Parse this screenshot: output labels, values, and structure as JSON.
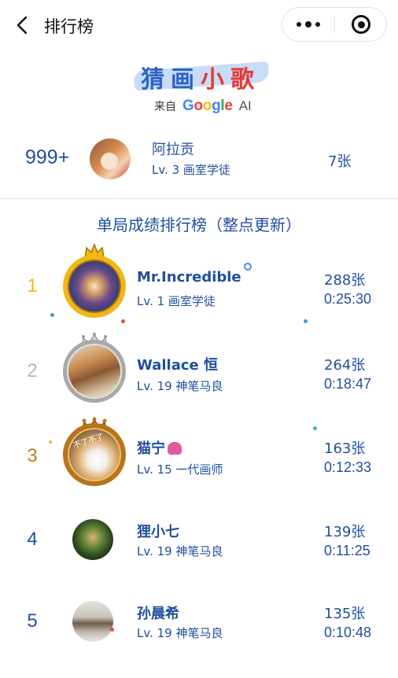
{
  "nav": {
    "title": "排行榜"
  },
  "logo": {
    "part1": "猜画",
    "part2": "小歌",
    "from": "来自",
    "google": "Google",
    "ai": "AI"
  },
  "me": {
    "rank": "999+",
    "name": "阿拉贡",
    "level": "Lv. 3 画室学徒",
    "count": "7张"
  },
  "section_title": "单局成绩排行榜（整点更新）",
  "leaderboard": [
    {
      "rank": "1",
      "name": "Mr.Incredible",
      "level": "Lv. 1 画室学徒",
      "count": "288张",
      "time": "0:25:30",
      "rank_color": "#f2b617"
    },
    {
      "rank": "2",
      "name": "Wallace 恒",
      "level": "Lv. 19 神笔马良",
      "count": "264张",
      "time": "0:18:47",
      "rank_color": "#b5b5b5"
    },
    {
      "rank": "3",
      "name": "猫宁",
      "level": "Lv. 15 一代画师",
      "count": "163张",
      "time": "0:12:33",
      "rank_color": "#c27a1e",
      "avatar_text": "不了不了"
    },
    {
      "rank": "4",
      "name": "狸小七",
      "level": "Lv. 19 神笔马良",
      "count": "139张",
      "time": "0:11:25",
      "rank_color": "#1f4e9e"
    },
    {
      "rank": "5",
      "name": "孙晨希",
      "level": "Lv. 19 神笔马良",
      "count": "135张",
      "time": "0:10:48",
      "rank_color": "#1f4e9e"
    }
  ],
  "google_colors": [
    "#4285F4",
    "#EA4335",
    "#FBBC05",
    "#4285F4",
    "#34A853",
    "#EA4335"
  ]
}
